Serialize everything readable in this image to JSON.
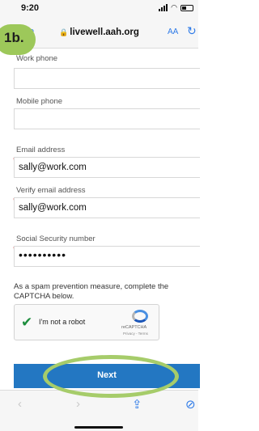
{
  "status_bar": {
    "time": "9:20"
  },
  "browser": {
    "url": "livewell.aah.org",
    "text_size_label": "AA"
  },
  "annotation": {
    "step": "1b."
  },
  "form": {
    "fields": [
      {
        "label": "Work phone",
        "value": "",
        "required": false
      },
      {
        "label": "Mobile phone",
        "value": "",
        "required": false
      },
      {
        "label": "Email address",
        "value": "sally@work.com",
        "required": true
      },
      {
        "label": "Verify email address",
        "value": "sally@work.com",
        "required": true
      },
      {
        "label": "Social Security number",
        "value": "••••••••••",
        "required": true
      }
    ],
    "required_marker": "*"
  },
  "captcha": {
    "instruction": "As a spam prevention measure, complete the CAPTCHA below.",
    "checkbox_label": "I'm not a robot",
    "brand": "reCAPTCHA",
    "terms": "Privacy - Terms"
  },
  "actions": {
    "next_label": "Next"
  },
  "colors": {
    "accent": "#2377c2",
    "highlight": "#a6cc6a",
    "required": "#dd3333"
  }
}
